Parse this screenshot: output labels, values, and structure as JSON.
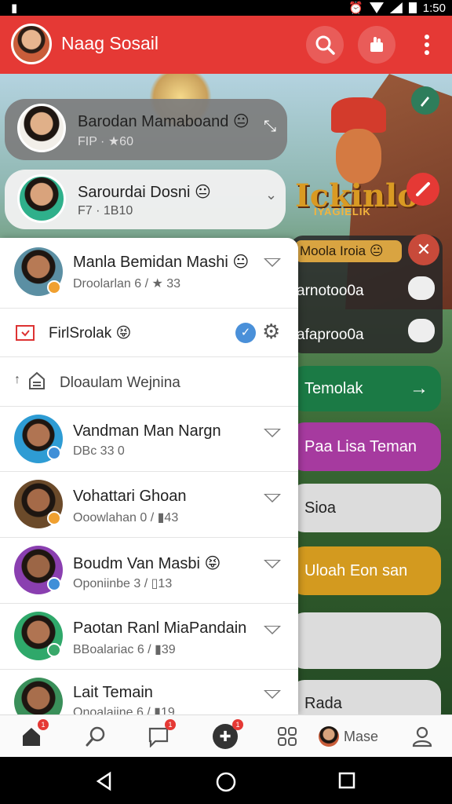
{
  "status_bar": {
    "left_icon": "sim-icon",
    "time": "1:50"
  },
  "header": {
    "title": "Naag Sosail",
    "color": "#e53935"
  },
  "scene": {
    "game_logo": "Ickinlo",
    "game_sub": "IYAGIELIK"
  },
  "floating_chats": [
    {
      "name": "Barodan Mamaboand 😐",
      "meta": "FIP · ★60"
    },
    {
      "name": "Sarourdai Dosni 😐",
      "meta": "F7 · 1B10"
    }
  ],
  "chat_list": [
    {
      "name": "Manla Bemidan Mashi 😐",
      "meta": "Droolarlan 6 / ★ 33"
    },
    {
      "type": "action",
      "label": "FirlSrolak 😝"
    },
    {
      "type": "section",
      "label": "Dloaulam Wejnina"
    },
    {
      "name": "Vandman Man Nargn",
      "meta": "DBc 33 0"
    },
    {
      "name": "Vohattari Ghoan",
      "meta": "Ooowlahan 0 / ▮43"
    },
    {
      "name": "Boudm Van Masbi 😝",
      "meta": "Oponiinbe 3 / ▯13"
    },
    {
      "name": "Paotan Ranl MiaPandain",
      "meta": "BBoalariac 6 / ▮39"
    },
    {
      "name": "Lait Temain",
      "meta": "Onoalaiine 6 / ▮19"
    }
  ],
  "right_panel": {
    "tag": "Moola Iroia 😐",
    "items": [
      "arnotoo0a",
      "afaproo0a"
    ],
    "pills": [
      {
        "label": "Temolak",
        "color": "#1b7a45"
      },
      {
        "label": "Paa Lisa Teman",
        "color": "#a63a9f"
      },
      {
        "label": "Sioa",
        "color": "#dcdcdc"
      },
      {
        "label": "Uloah Eon san",
        "color": "#d39a1f"
      },
      {
        "label": "",
        "color": "#dcdcdc"
      },
      {
        "label": "Rada",
        "color": "#dcdcdc"
      }
    ]
  },
  "bottom_nav": {
    "items": [
      {
        "icon": "home-icon",
        "badge": "1"
      },
      {
        "icon": "search-icon",
        "badge": ""
      },
      {
        "icon": "chat-icon",
        "badge": "1"
      },
      {
        "icon": "add-friend-icon",
        "badge": "1"
      },
      {
        "icon": "apps-icon",
        "badge": ""
      },
      {
        "icon": "avatar",
        "label": "Mase"
      },
      {
        "icon": "profile-icon",
        "badge": ""
      }
    ]
  }
}
